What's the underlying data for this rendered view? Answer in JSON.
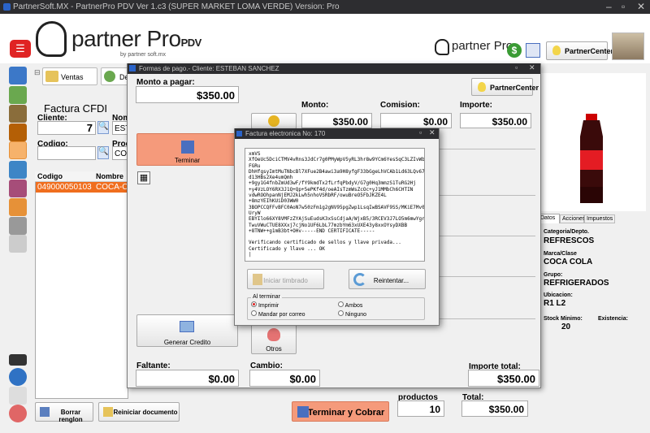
{
  "window": {
    "title": "PartnerSoft.MX  -  PartnerPro PDV Ver 1.c3 (SUPER MARKET LOMA VERDE) Version: Pro"
  },
  "header": {
    "brand": "partner",
    "brand_pro": "Pro",
    "brand_pdv": "PDV",
    "brand_by": "by partner soft.mx",
    "small_brand": "partner Pro",
    "partnercenter_label": "PartnerCenter"
  },
  "toolbar": {
    "ventas_label": "Ventas",
    "second_tab": "De"
  },
  "factura": {
    "title": "Factura CFDI",
    "cliente_label": "Cliente:",
    "cliente_value": "7",
    "nombre_label": "Nombre",
    "nombre_value": "EST",
    "codigo_label": "Codigo:",
    "producto_label": "Prod",
    "producto_value": "COC"
  },
  "grid": {
    "headers": [
      "Codigo",
      "Nombre"
    ],
    "rows": [
      [
        "049000050103",
        "COCA-CO"
      ]
    ]
  },
  "bottom": {
    "borrar": "Borrar renglon",
    "reiniciar": "Reiniciar documento",
    "terminar_cobrar": "Terminar y Cobrar",
    "productos_label": "productos",
    "productos_value": "10",
    "total_label": "Total:",
    "total_value": "$350.00"
  },
  "right": {
    "tabs": [
      "Datos",
      "Acciones",
      "Impuestos"
    ],
    "categoria_label": "Categoria/Depto.",
    "categoria_value": "REFRESCOS",
    "marca_label": "Marca/Clase",
    "marca_value": "COCA COLA",
    "grupo_label": "Grupo:",
    "grupo_value": "REFRIGERADOS",
    "ubicacion_label": "Ubicacion:",
    "ubicacion_value": "R1 L2",
    "stock_label": "Stock Minimo:",
    "stock_value": "20",
    "existencia_label": "Existencia:"
  },
  "formas_pago": {
    "title": "Formas de pago.- Cliente: ESTEBAN SANCHEZ",
    "monto_pagar_label": "Monto a pagar:",
    "monto_pagar_value": "$350.00",
    "partnercenter": "PartnerCenter",
    "monto_label": "Monto:",
    "monto_value": "$350.00",
    "comision_label": "Comision:",
    "comision_value": "$0.00",
    "importe_label": "Importe:",
    "importe_value": "$350.00",
    "terminar": "Terminar",
    "generar_credito": "Generar Credito",
    "otros": "Otros",
    "faltante_label": "Faltante:",
    "faltante_value": "$0.00",
    "cambio_label": "Cambio:",
    "cambio_value": "$0.00",
    "importe_total_label": "Importe total:",
    "importe_total_value": "$350.00"
  },
  "factura_electronica": {
    "title": "Factura electronica No: 170",
    "log": "xmVS\nXfOeUc5DciCTMV4vRns3JdCr7g0PMyWpV5yRL3hr8w9YCm6YesSqC3LZIvWb\nFGRu\nDhHfgsyImtMuTNbcBl7XFue2B4awi3a9H8yfgF33bGgeLhVCAb1Ld63LQv67zG\nd13HBs2Xe4umQmh\n+9gy1G4fnbZmUd3wF/fY9kmdTx2fLrfqPbdyV/G7g0Hq3mmzS1TuRG2Hj\n+y4VzLOY6RX3J1Q+Qp+5ePKf4d/oeAIsTzmWsZcOc+yJ1MMbCh6CHTIN\nvdwROOhpanNjEMJ2kLwh5nhoVSRbRF/owuBreO5FbJKZE4L\n+8mzYEIhKUiD03WW0\n3BOPCCQFFvBFC0AoN7w50zFm1g2gNV95pgZwp1LsqIwBSAVF9SS/MKiE7Mv0\nUryW\nEBYIlo66XY8VMFzZYAjSuEudsK3xSsCdjaA/WjxB5/3RCEV3J7LO5m6mwYgrQ1a\nTwuVWuCTUE8XXxj7cjNo1UF6LbL77mzbYm63xUXE43y8xxOYsyDXBB\n+8TNW++g1mB3bt+OHv-----END CERTIFICATE-----\n\nVerificando certificado de sellos y llave privada...\nCertificado y llave ... OK\n|",
    "iniciar": "Iniciar timbrado",
    "reintentar": "Reintentar...",
    "al_terminar": "Al terminar",
    "opt_imprimir": "Imprimir",
    "opt_ambos": "Ambos",
    "opt_mandar": "Mandar por correo",
    "opt_ninguno": "Ninguno"
  },
  "colors": {
    "accent_orange": "#f06e1e",
    "titlebar": "#2d2d30",
    "button_orange": "#f59a7b"
  }
}
